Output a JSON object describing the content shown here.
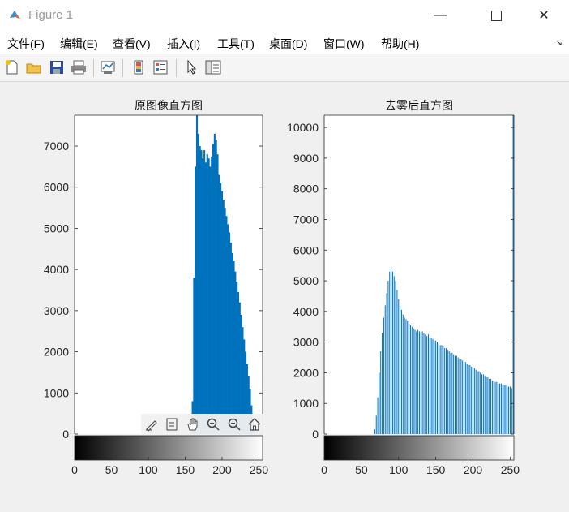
{
  "window": {
    "title": "Figure 1"
  },
  "menu": [
    "文件(F)",
    "编辑(E)",
    "查看(V)",
    "插入(I)",
    "工具(T)",
    "桌面(D)",
    "窗口(W)",
    "帮助(H)"
  ],
  "colors": {
    "bar": "#0072bd",
    "axis": "#262626",
    "background": "#f0f0f0"
  },
  "chart_data": [
    {
      "type": "bar",
      "title": "原图像直方图",
      "xlim": [
        0,
        255
      ],
      "ylim": [
        0,
        7750
      ],
      "yticks": [
        0,
        1000,
        2000,
        3000,
        4000,
        5000,
        6000,
        7000
      ],
      "xticks": [
        0,
        50,
        100,
        150,
        200,
        250
      ],
      "colorbar": "gray",
      "x": [
        160,
        162,
        164,
        166,
        168,
        170,
        172,
        174,
        176,
        178,
        180,
        182,
        184,
        186,
        188,
        190,
        192,
        194,
        196,
        198,
        200,
        202,
        204,
        206,
        208,
        210,
        212,
        214,
        216,
        218,
        220,
        222,
        224,
        226,
        228,
        230,
        232,
        234,
        236,
        238,
        240,
        242
      ],
      "values": [
        800,
        3800,
        6500,
        7750,
        7300,
        7000,
        6900,
        6700,
        6900,
        6600,
        6800,
        6700,
        6500,
        6750,
        7050,
        7300,
        7150,
        6800,
        6300,
        6100,
        5900,
        5700,
        5500,
        5300,
        5100,
        4900,
        4650,
        4400,
        4200,
        3950,
        3700,
        3450,
        3200,
        2900,
        2600,
        2300,
        2000,
        1700,
        1400,
        1100,
        700,
        300
      ]
    },
    {
      "type": "bar",
      "title": "去雾后直方图",
      "xlim": [
        0,
        255
      ],
      "ylim": [
        0,
        10400
      ],
      "yticks": [
        0,
        1000,
        2000,
        3000,
        4000,
        5000,
        6000,
        7000,
        8000,
        9000,
        10000
      ],
      "xticks": [
        0,
        50,
        100,
        150,
        200,
        250
      ],
      "colorbar": "gray",
      "x": [
        68,
        70,
        72,
        74,
        76,
        78,
        80,
        82,
        84,
        86,
        88,
        90,
        92,
        94,
        96,
        98,
        100,
        102,
        104,
        106,
        108,
        110,
        112,
        114,
        116,
        118,
        120,
        122,
        124,
        126,
        128,
        130,
        132,
        134,
        136,
        138,
        140,
        142,
        144,
        146,
        148,
        150,
        152,
        154,
        156,
        158,
        160,
        162,
        164,
        166,
        168,
        170,
        172,
        174,
        176,
        178,
        180,
        182,
        184,
        186,
        188,
        190,
        192,
        194,
        196,
        198,
        200,
        202,
        204,
        206,
        208,
        210,
        212,
        214,
        216,
        218,
        220,
        222,
        224,
        226,
        228,
        230,
        232,
        234,
        236,
        238,
        240,
        242,
        244,
        246,
        248,
        250,
        252,
        254
      ],
      "values": [
        150,
        600,
        1200,
        2000,
        2700,
        3300,
        3800,
        4200,
        4600,
        5000,
        5300,
        5450,
        5300,
        5150,
        5000,
        4700,
        4400,
        4200,
        4050,
        3900,
        3800,
        3750,
        3700,
        3600,
        3550,
        3500,
        3450,
        3400,
        3350,
        3400,
        3350,
        3300,
        3350,
        3300,
        3250,
        3200,
        3250,
        3150,
        3150,
        3100,
        3050,
        3050,
        3000,
        2950,
        2900,
        2900,
        2850,
        2800,
        2800,
        2750,
        2700,
        2650,
        2650,
        2600,
        2550,
        2550,
        2500,
        2450,
        2450,
        2400,
        2350,
        2350,
        2300,
        2250,
        2250,
        2200,
        2150,
        2150,
        2100,
        2050,
        2050,
        2000,
        1950,
        1950,
        1900,
        1850,
        1850,
        1800,
        1800,
        1750,
        1750,
        1700,
        1700,
        1650,
        1650,
        1650,
        1600,
        1600,
        1600,
        1550,
        1550,
        1550,
        1500,
        10400
      ]
    }
  ]
}
